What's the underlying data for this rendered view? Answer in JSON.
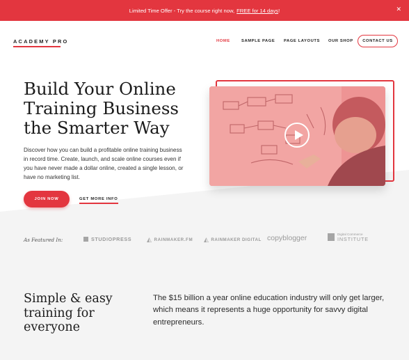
{
  "announcement": {
    "text": "Limited Time Offer - Try the course right now,",
    "link": "FREE for 14 days",
    "suffix": "!"
  },
  "header": {
    "logo": "ACADEMY PRO",
    "nav": [
      "HOME",
      "SAMPLE PAGE",
      "PAGE LAYOUTS",
      "OUR SHOP"
    ],
    "contact": "CONTACT US",
    "active_nav": "HOME"
  },
  "hero": {
    "title_lines": [
      "Build Your Online",
      "Training Business",
      "the Smarter Way"
    ],
    "description": "Discover how you can build a profitable online training business in record time. Create, launch, and scale online courses even if you have never made a dollar online, created a single lesson, or have no marketing list.",
    "primary_button": "JOIN NOW",
    "secondary_link": "GET MORE INFO"
  },
  "featured": {
    "label": "As Featured In:",
    "brands": [
      "STUDIOPRESS",
      "RAINMAKER.FM",
      "RAINMAKER DIGITAL",
      "copyblogger",
      "Digital Commerce",
      "INSTITUTE"
    ]
  },
  "section": {
    "title_lines": [
      "Simple & easy",
      "training for",
      "everyone"
    ],
    "description": "The $15 billion a year online education industry will only get larger, which means it represents a huge opportunity for savvy digital entrepreneurs."
  },
  "colors": {
    "accent": "#e3363f",
    "band": "#f4f4f4"
  },
  "icons": [
    "close-icon",
    "play-icon",
    "studiopress-logo-icon",
    "rainmaker-logo-icon",
    "dcinstitute-logo-icon"
  ]
}
